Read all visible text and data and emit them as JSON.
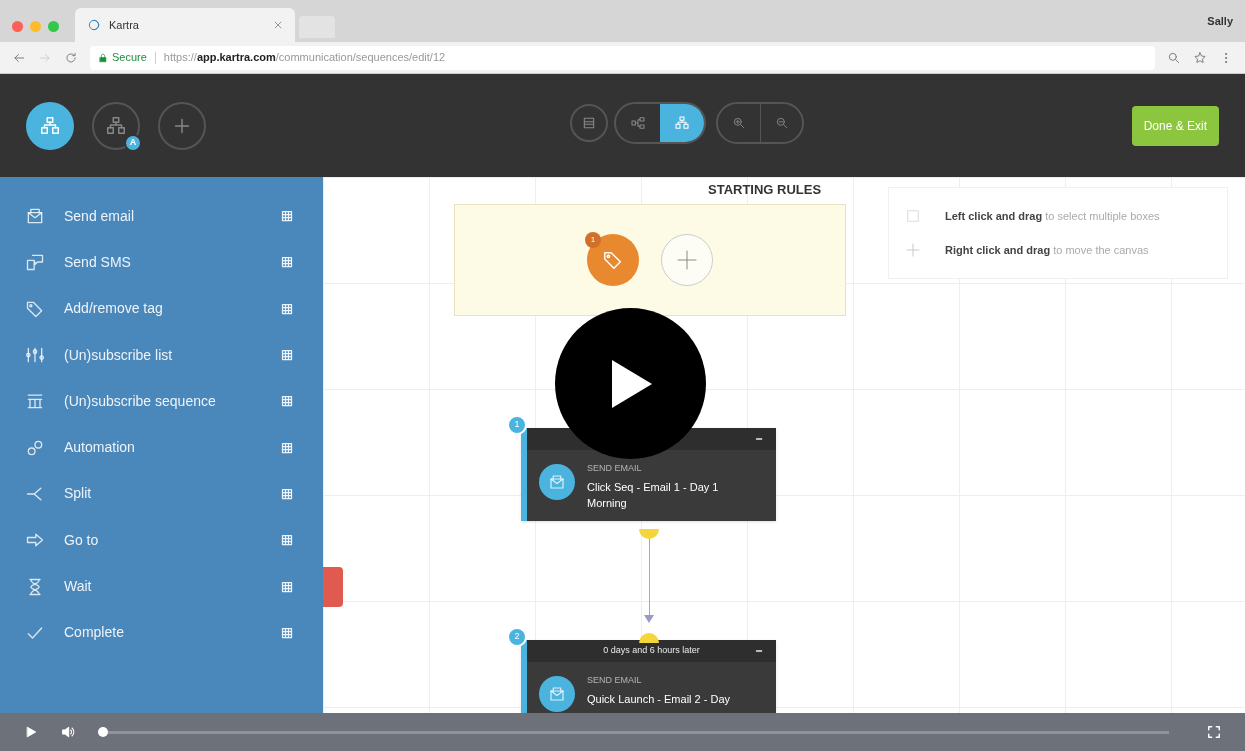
{
  "browser": {
    "tab_title": "Kartra",
    "profile": "Sally",
    "secure_label": "Secure",
    "url": "https://**app.kartra.com**/communication/sequences/edit/12"
  },
  "toolbar": {
    "left_buttons": [
      {
        "kind": "flow",
        "selected": true
      },
      {
        "kind": "flow-badge",
        "selected": false,
        "badge": "A"
      },
      {
        "kind": "add",
        "selected": false
      }
    ],
    "view_buttons": [
      {
        "kind": "list",
        "selected": false
      },
      {
        "kind": "horizontal",
        "selected": false
      },
      {
        "kind": "vertical",
        "selected": true
      }
    ],
    "zoom_buttons": [
      {
        "kind": "zoom-in"
      },
      {
        "kind": "zoom-out"
      }
    ],
    "done_button": "Done & Exit"
  },
  "sidebar": {
    "items": [
      {
        "kind": "email",
        "label": "Send email"
      },
      {
        "kind": "sms",
        "label": "Send SMS"
      },
      {
        "kind": "tag",
        "label": "Add/remove tag"
      },
      {
        "kind": "list",
        "label": "(Un)subscribe list"
      },
      {
        "kind": "sequence",
        "label": "(Un)subscribe sequence"
      },
      {
        "kind": "automation",
        "label": "Automation"
      },
      {
        "kind": "split",
        "label": "Split"
      },
      {
        "kind": "goto",
        "label": "Go to"
      },
      {
        "kind": "wait",
        "label": "Wait"
      },
      {
        "kind": "complete",
        "label": "Complete"
      }
    ]
  },
  "canvas": {
    "starting_rules": {
      "title": "STARTING RULES",
      "rule_count": "1"
    },
    "hints": [
      {
        "kind": "select",
        "text": "**Left click and drag** to select multiple boxes"
      },
      {
        "kind": "move",
        "text": "**Right click and drag** to move the canvas"
      }
    ],
    "nodes": [
      {
        "number": "1",
        "type_label": "SEND EMAIL",
        "title": "Click Seq - Email 1 - Day 1 Morning"
      },
      {
        "number": "2",
        "delay": "0 days and 6 hours later",
        "type_label": "SEND EMAIL",
        "title": "Quick Launch - Email 2 - Day"
      }
    ]
  },
  "player": {
    "level": 0
  }
}
